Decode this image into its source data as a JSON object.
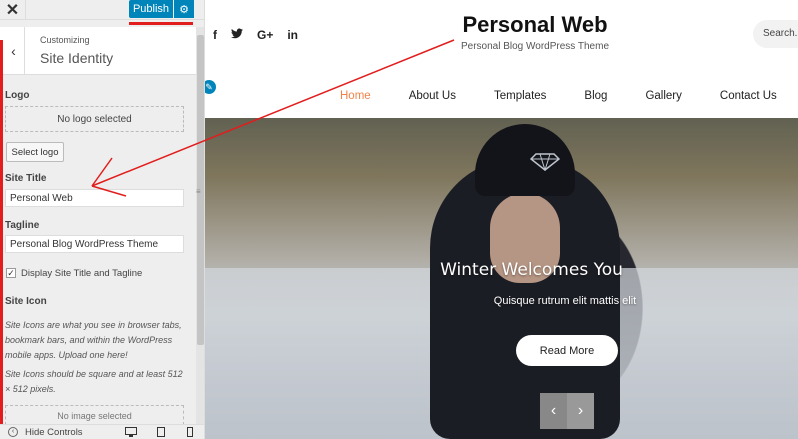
{
  "panel": {
    "close_icon": "close-icon",
    "publish_label": "Publish",
    "gear_icon": "gear-icon",
    "crumb": "Customizing",
    "section_title": "Site Identity",
    "logo_label": "Logo",
    "logo_box": "No logo selected",
    "select_logo": "Select logo",
    "site_title_label": "Site Title",
    "site_title_value": "Personal Web",
    "tagline_label": "Tagline",
    "tagline_value": "Personal Blog WordPress Theme",
    "display_checkbox_label": "Display Site Title and Tagline",
    "site_icon_label": "Site Icon",
    "site_icon_note1": "Site Icons are what you see in browser tabs, bookmark bars, and within the WordPress mobile apps. Upload one here!",
    "site_icon_note2": "Site Icons should be square and at least 512 × 512 pixels.",
    "site_icon_box": "No image selected",
    "hide_controls": "Hide Controls"
  },
  "preview": {
    "social": [
      "f",
      "t",
      "G+",
      "in"
    ],
    "site_title": "Personal Web",
    "tagline": "Personal Blog WordPress Theme",
    "search_placeholder": "Search...",
    "nav": [
      "Home",
      "About Us",
      "Templates",
      "Blog",
      "Gallery",
      "Contact Us"
    ],
    "hero_title": "Winter Welcomes You",
    "hero_subtitle": "Quisque rutrum elit mattis elit",
    "read_more": "Read More"
  },
  "colors": {
    "publish": "#0085ba",
    "accent_red": "#e21d1d",
    "nav_active": "#f0834b"
  }
}
